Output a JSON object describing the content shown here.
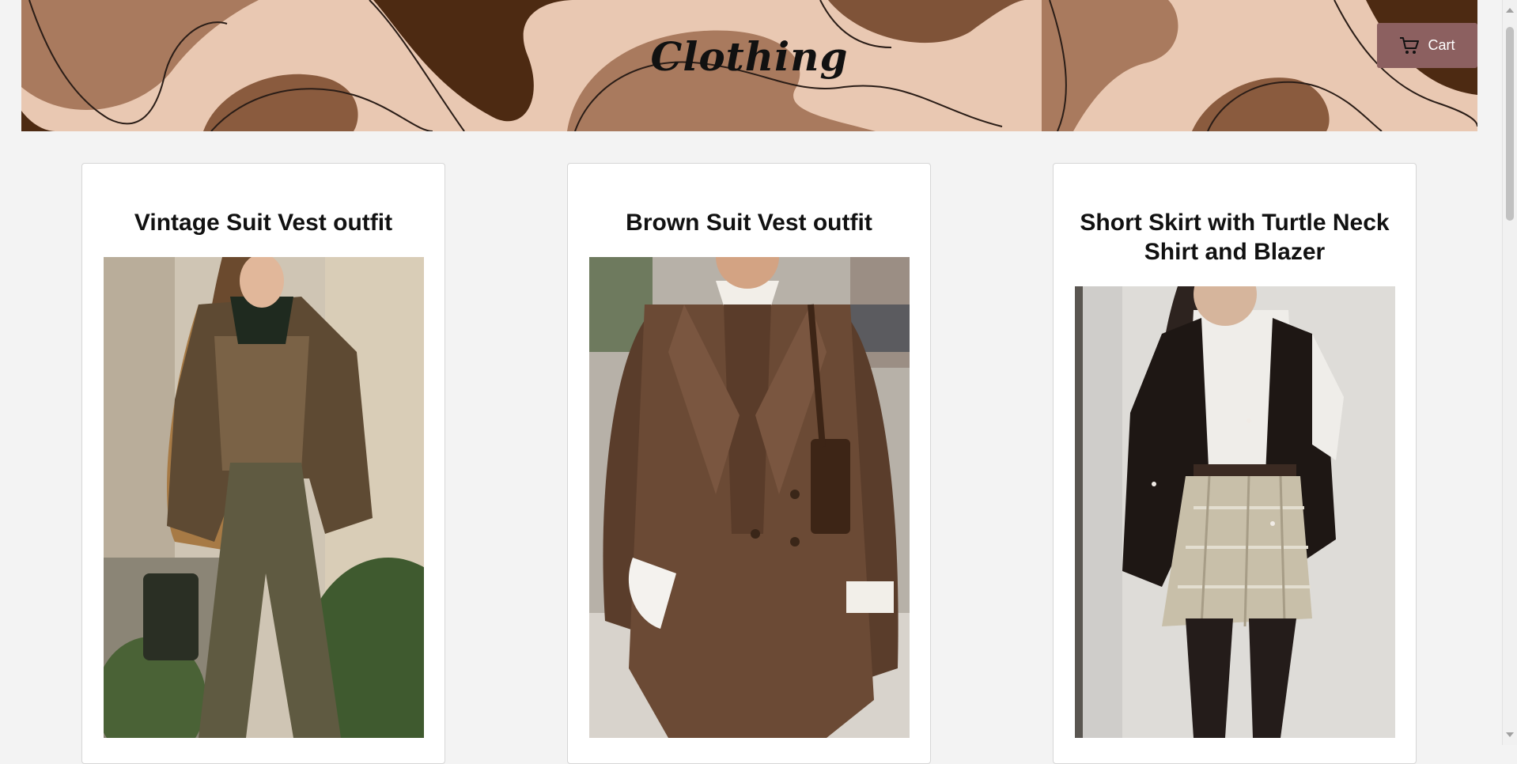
{
  "header": {
    "title": "Clothing",
    "cart_label": "Cart",
    "cart_icon": "cart-icon"
  },
  "products": [
    {
      "title": "Vintage Suit Vest outfit"
    },
    {
      "title": "Brown Suit Vest outfit"
    },
    {
      "title": "Short Skirt with Turtle Neck Shirt and Blazer"
    }
  ],
  "colors": {
    "banner_light": "#e9c8b2",
    "banner_mid": "#a97a5e",
    "banner_dark": "#4d2a12",
    "cart_button": "#8c6060",
    "page_bg": "#f3f3f3"
  }
}
